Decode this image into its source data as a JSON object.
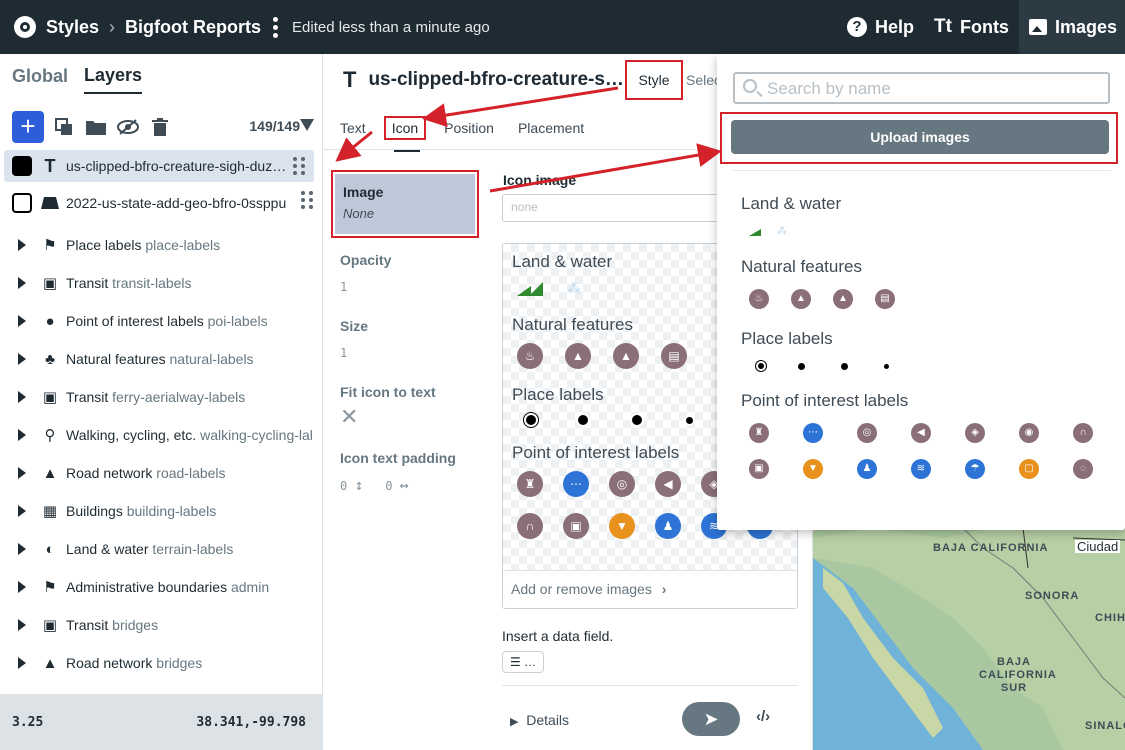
{
  "topbar": {
    "crumb_styles": "Styles",
    "crumb_style_name": "Bigfoot Reports",
    "edited": "Edited less than a minute ago",
    "help": "Help",
    "fonts": "Fonts",
    "images": "Images"
  },
  "left": {
    "tab_global": "Global",
    "tab_layers": "Layers",
    "count": "149/149",
    "layers": [
      {
        "name": "us-clipped-bfro-creature-sigh-duz…",
        "icon": "text-icon",
        "swatch": "#000000"
      },
      {
        "name": "2022-us-state-add-geo-bfro-0ssppu",
        "icon": "fill-icon",
        "swatch": "#ffffff"
      }
    ],
    "groups": [
      {
        "name": "Place labels",
        "id": "place-labels",
        "icon": "place-icon"
      },
      {
        "name": "Transit",
        "id": "transit-labels",
        "icon": "train-icon"
      },
      {
        "name": "Point of interest labels",
        "id": "poi-labels",
        "icon": "pin-icon"
      },
      {
        "name": "Natural features",
        "id": "natural-labels",
        "icon": "tree-icon"
      },
      {
        "name": "Transit",
        "id": "ferry-aerialway-labels",
        "icon": "train-icon"
      },
      {
        "name": "Walking, cycling, etc.",
        "id": "walking-cycling-lal",
        "icon": "walk-icon"
      },
      {
        "name": "Road network",
        "id": "road-labels",
        "icon": "road-icon"
      },
      {
        "name": "Buildings",
        "id": "building-labels",
        "icon": "building-icon"
      },
      {
        "name": "Land & water",
        "id": "terrain-labels",
        "icon": "globe-icon"
      },
      {
        "name": "Administrative boundaries",
        "id": "admin",
        "icon": "flag-icon"
      },
      {
        "name": "Transit",
        "id": "bridges",
        "icon": "train-icon"
      },
      {
        "name": "Road network",
        "id": "bridges",
        "icon": "road-icon"
      }
    ],
    "zoom": "3.25",
    "coords": "38.341,-99.798"
  },
  "mid": {
    "layer_title": "us-clipped-bfro-creature-s…",
    "tab_style": "Style",
    "tab_select": "Selec",
    "subtabs": [
      "Text",
      "Icon",
      "Position",
      "Placement"
    ],
    "image_label": "Image",
    "image_value": "None",
    "opacity_label": "Opacity",
    "opacity_value": "1",
    "size_label": "Size",
    "size_value": "1",
    "fit_label": "Fit icon to text",
    "padding_label": "Icon text padding",
    "padding_v": "0",
    "padding_h": "0",
    "icon_image_label": "Icon image",
    "icon_input_placeholder": "none",
    "gallery_sections": [
      "Land & water",
      "Natural features",
      "Place labels",
      "Point of interest labels"
    ],
    "add_remove": "Add or remove images",
    "insert_field": "Insert a data field.",
    "insert_btn": "…",
    "details": "Details"
  },
  "pop": {
    "search_placeholder": "Search by name",
    "upload": "Upload images",
    "sections": [
      "Land & water",
      "Natural features",
      "Place labels",
      "Point of interest labels"
    ]
  },
  "map": {
    "labels": [
      "BAJA CALIFORNIA",
      "SONORA",
      "CHIHU",
      "BAJA CALIFORNIA SUR",
      "SINALO",
      "Ciudad"
    ]
  },
  "colors": {
    "topbar": "#1f2b33",
    "accent": "#2d5dd9",
    "highlight": "#d3222a",
    "selected_row": "#dbe3ee"
  }
}
